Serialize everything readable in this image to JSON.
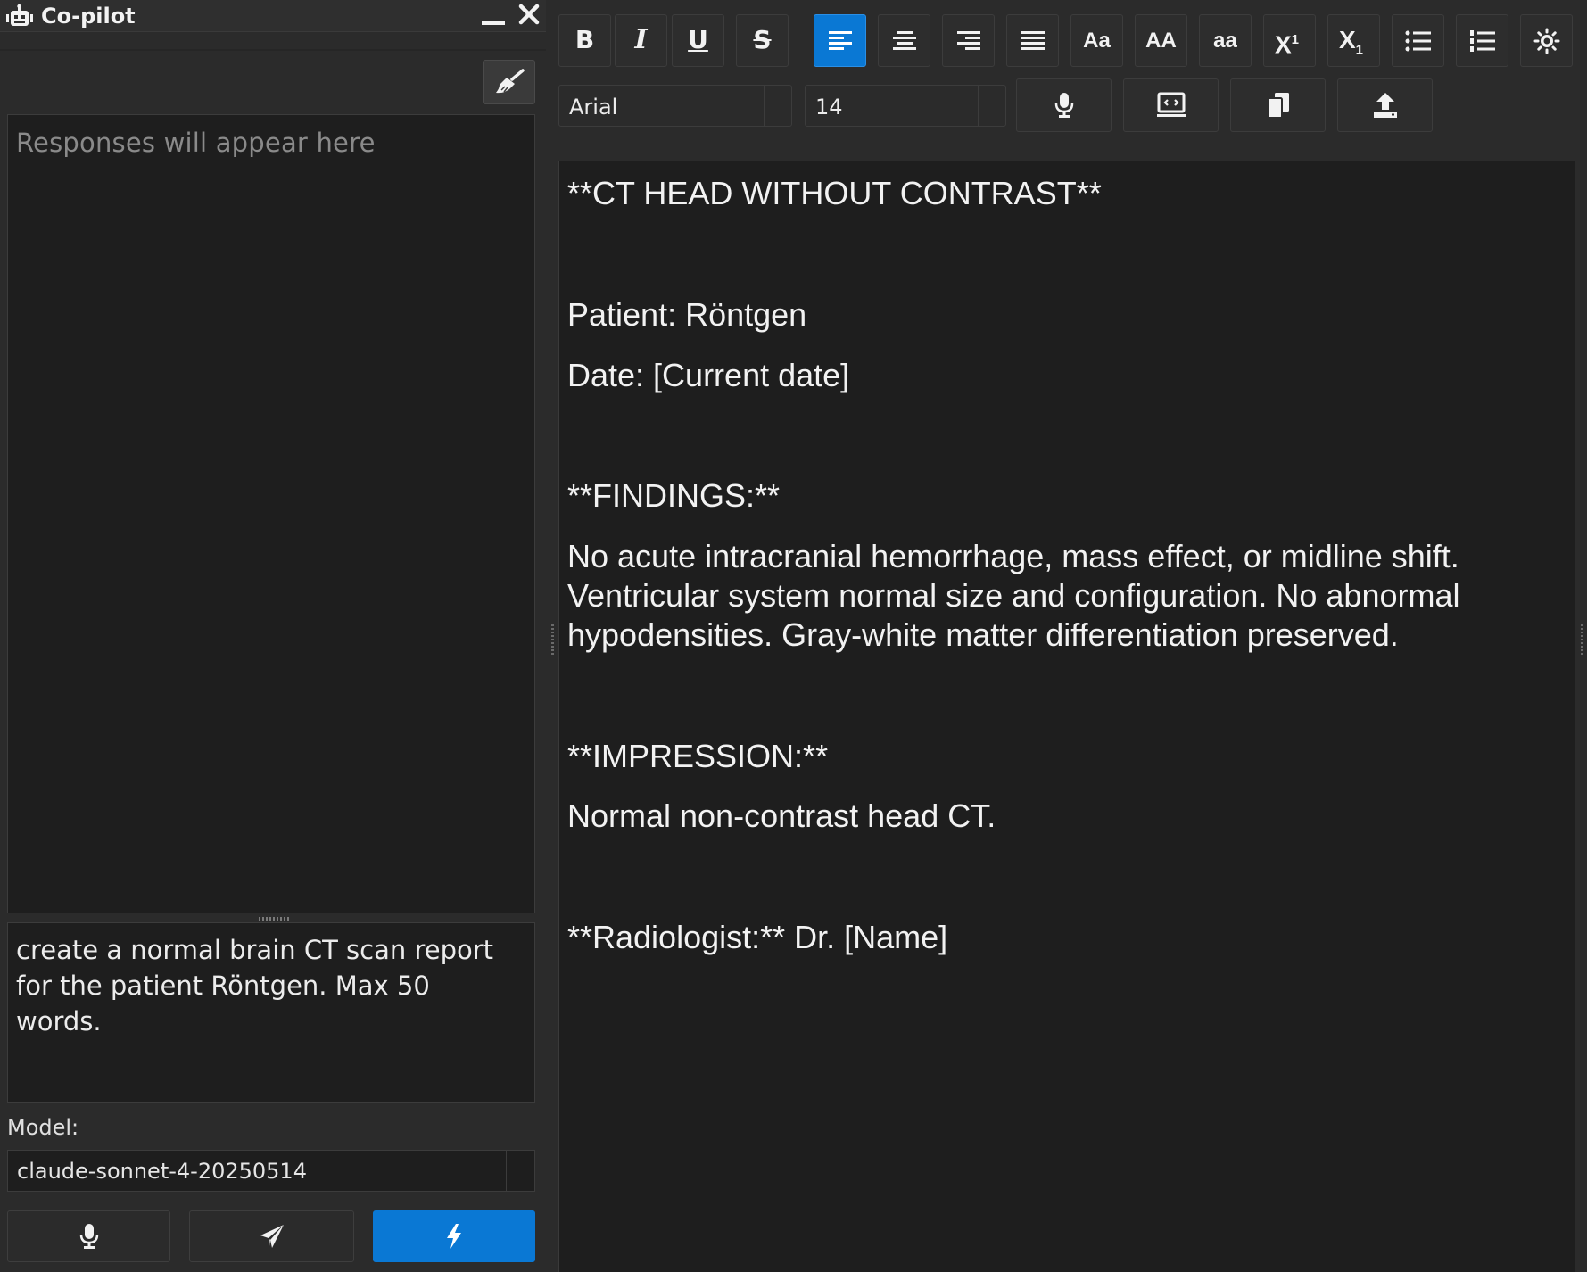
{
  "copilot": {
    "title": "Co-pilot",
    "icons": {
      "app": "robot-icon",
      "minimize": "minimize-icon",
      "close": "close-icon",
      "clear": "broom-icon"
    },
    "response_placeholder": "Responses will appear here",
    "prompt_text": "create a normal brain CT scan report for the patient Röntgen. Max 50 words.",
    "model_label": "Model:",
    "model_value": "claude-sonnet-4-20250514",
    "bottom_buttons": [
      {
        "icon": "microphone-icon"
      },
      {
        "icon": "send-icon"
      },
      {
        "icon": "lightning-icon",
        "accent": "#0a78d4"
      }
    ]
  },
  "toolbar": {
    "format_buttons": [
      {
        "label": "B",
        "name": "bold"
      },
      {
        "label": "I",
        "name": "italic"
      },
      {
        "label": "U",
        "name": "underline"
      },
      {
        "label": "S",
        "name": "strikethrough"
      },
      {
        "icon": "align-left-icon",
        "name": "align-left",
        "active": true
      },
      {
        "icon": "align-center-icon",
        "name": "align-center"
      },
      {
        "icon": "align-right-icon",
        "name": "align-right"
      },
      {
        "icon": "align-justify-icon",
        "name": "align-justify"
      },
      {
        "label": "Aa",
        "name": "sentence-case"
      },
      {
        "label": "AA",
        "name": "uppercase"
      },
      {
        "label": "aa",
        "name": "lowercase"
      },
      {
        "label": "X",
        "sup": "1",
        "name": "superscript"
      },
      {
        "label": "X",
        "sub": "1",
        "name": "subscript"
      },
      {
        "icon": "bullet-list-icon",
        "name": "bullet-list"
      },
      {
        "icon": "numbered-list-icon",
        "name": "numbered-list"
      },
      {
        "icon": "brightness-icon",
        "name": "theme-toggle"
      }
    ],
    "font_family": "Arial",
    "font_size": "14",
    "tools": [
      {
        "icon": "microphone-icon",
        "name": "dictate"
      },
      {
        "icon": "screen-icon",
        "name": "screen-capture"
      },
      {
        "icon": "copy-icon",
        "name": "copy"
      },
      {
        "icon": "upload-icon",
        "name": "upload"
      }
    ],
    "accent": "#0a78d4"
  },
  "document": {
    "heading": "**CT HEAD WITHOUT CONTRAST**",
    "patient": "Patient: Röntgen",
    "date": "Date: [Current date]",
    "findings_heading": "**FINDINGS:**",
    "findings_text": "No acute intracranial hemorrhage, mass effect, or midline shift. Ventricular system normal size and configuration. No abnormal hypodensities. Gray-white matter differentiation preserved.",
    "impression_heading": "**IMPRESSION:**",
    "impression_text": "Normal non-contrast head CT.",
    "radiologist": "**Radiologist:** Dr. [Name]"
  }
}
